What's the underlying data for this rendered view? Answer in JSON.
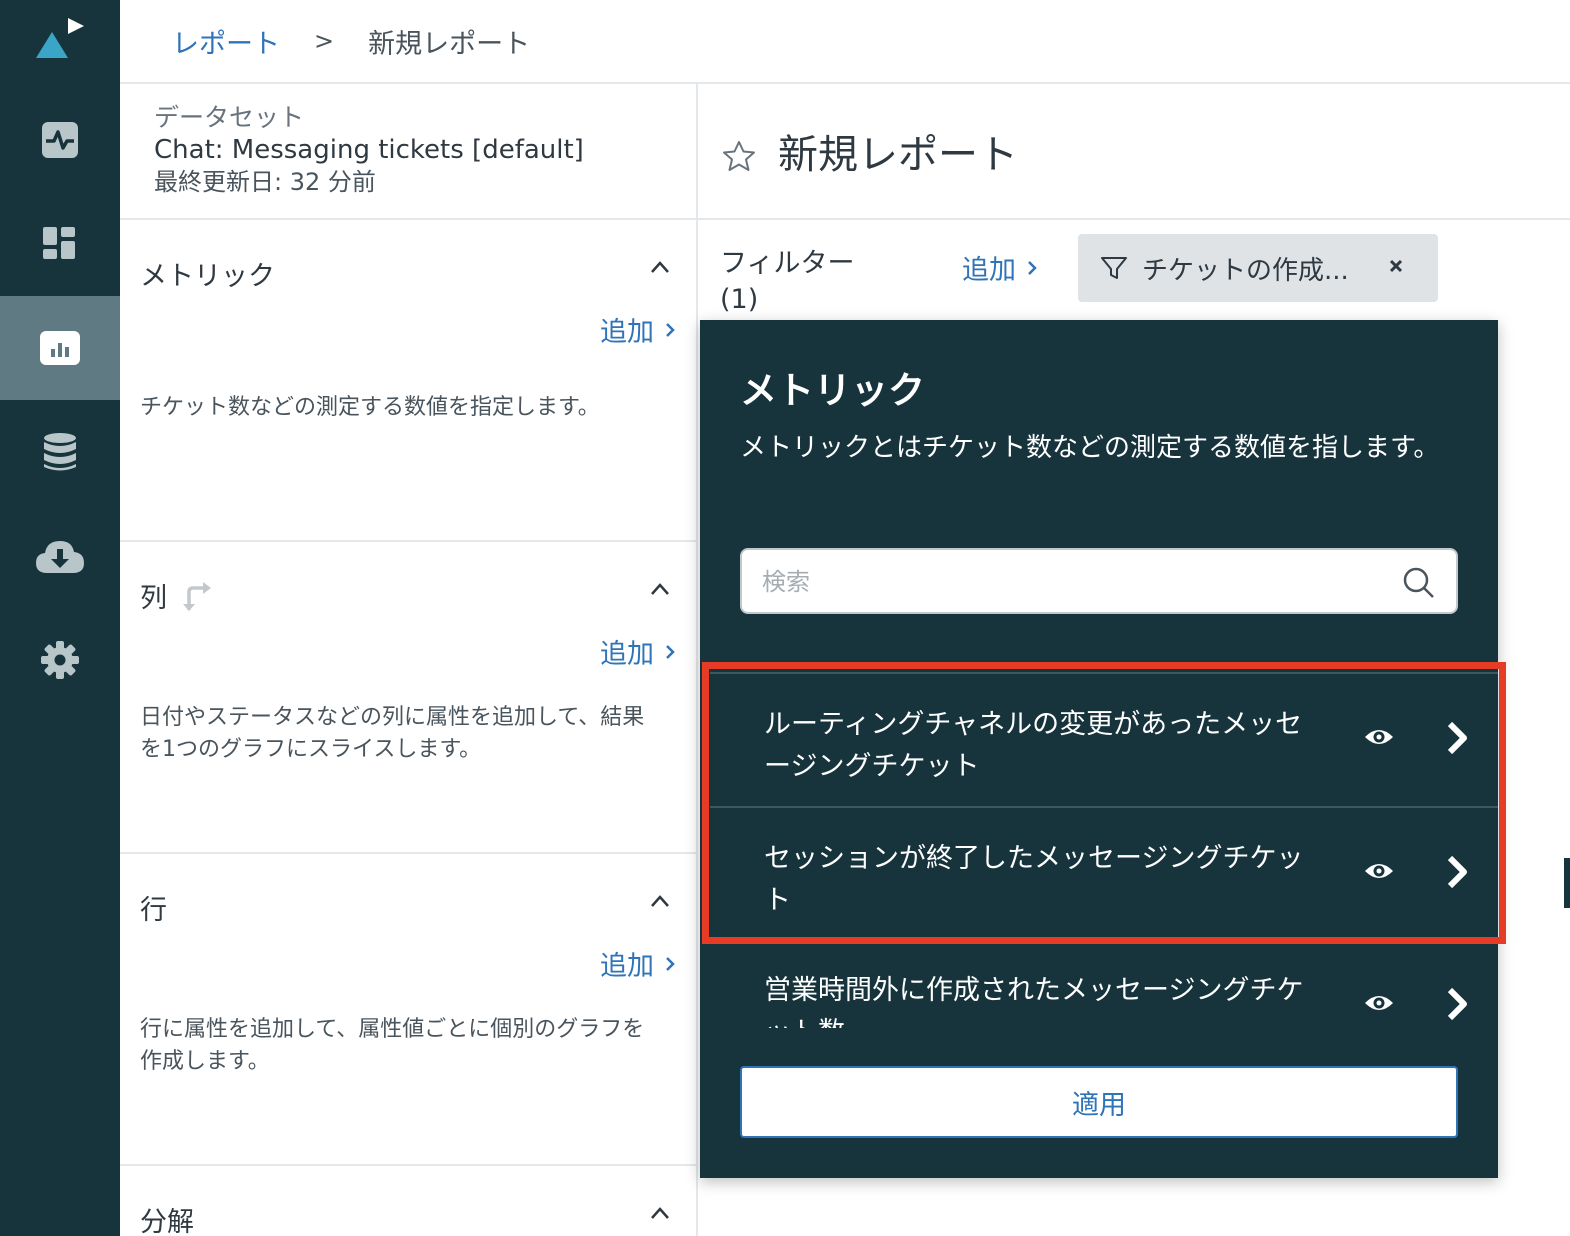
{
  "breadcrumb": {
    "parent": "レポート",
    "separator": ">",
    "current": "新規レポート"
  },
  "nav": {
    "items": [
      {
        "name": "activity-icon",
        "active": false
      },
      {
        "name": "dashboard-icon",
        "active": false
      },
      {
        "name": "reports-icon",
        "active": true
      },
      {
        "name": "database-icon",
        "active": false
      },
      {
        "name": "cloud-download-icon",
        "active": false
      },
      {
        "name": "settings-icon",
        "active": false
      }
    ]
  },
  "dataset": {
    "label": "データセット",
    "name": "Chat: Messaging tickets [default]",
    "updated": "最終更新日: 32 分前"
  },
  "sections": {
    "metrics": {
      "title": "メトリック",
      "add": "追加",
      "desc": "チケット数などの測定する数値を指定します。"
    },
    "columns": {
      "title": "列",
      "add": "追加",
      "desc": "日付やステータスなどの列に属性を追加して、結果を1つのグラフにスライスします。"
    },
    "rows": {
      "title": "行",
      "add": "追加",
      "desc": "行に属性を追加して、属性値ごとに個別のグラフを作成します。"
    },
    "explode": {
      "title": "分解"
    }
  },
  "main": {
    "title": "新規レポート"
  },
  "filter": {
    "label": "フィルター",
    "count": "(1)",
    "add": "追加",
    "pill": "チケットの作成..."
  },
  "popover": {
    "title": "メトリック",
    "desc": "メトリックとはチケット数などの測定する数値を指します。",
    "search_placeholder": "検索",
    "items": [
      {
        "label": "ルーティングチャネルの変更があったメッセージングチケット"
      },
      {
        "label": "セッションが終了したメッセージングチケット"
      },
      {
        "label": "営業時間外に作成されたメッセージングチケット数"
      }
    ],
    "apply": "適用"
  },
  "colors": {
    "nav_bg": "#17343d",
    "nav_active": "#5f7a82",
    "link": "#2f73b8",
    "highlight": "#e63b24",
    "logo_accent": "#3aa5c7"
  }
}
